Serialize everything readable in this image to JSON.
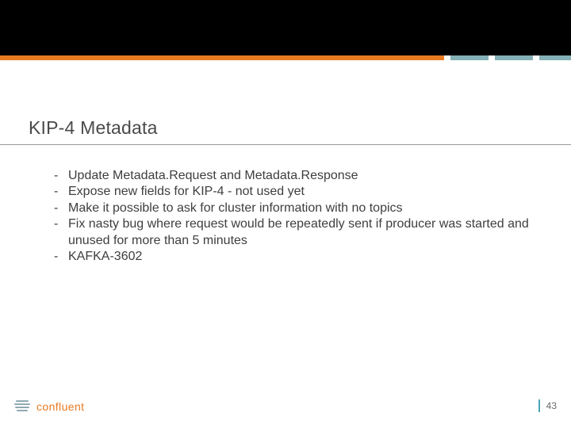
{
  "slide": {
    "title": "KIP-4 Metadata",
    "bullets": [
      "Update Metadata.Request and Metadata.Response",
      "Expose new fields for KIP-4 - not used yet",
      "Make it possible to ask for cluster information with no topics",
      "Fix nasty bug where request would be repeatedly sent if producer was started and unused for more than 5 minutes",
      "KAFKA-3602"
    ]
  },
  "footer": {
    "brand": "confluent",
    "page_number": "43"
  },
  "colors": {
    "accent_orange": "#e87b22",
    "accent_teal": "#84b0b6",
    "page_bar": "#4aa6b7"
  }
}
